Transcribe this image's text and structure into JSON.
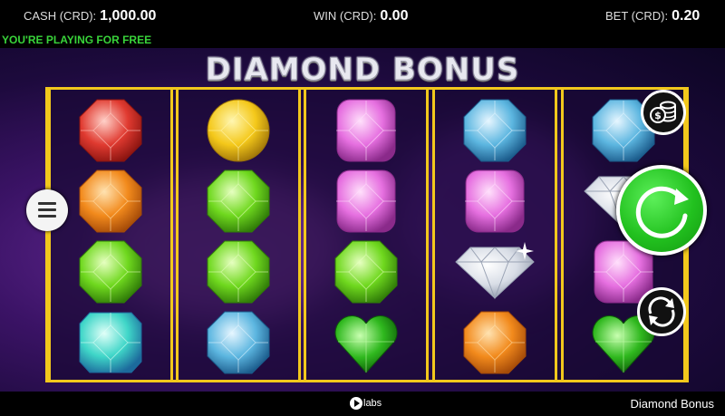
{
  "header": {
    "cash_label": "CASH (CRD):",
    "cash_value": "1,000.00",
    "win_label": "WIN (CRD):",
    "win_value": "0.00",
    "bet_label": "BET (CRD):",
    "bet_value": "0.20"
  },
  "banner": {
    "free_play": "YOU'RE PLAYING FOR FREE"
  },
  "game": {
    "title": "DIAMOND BONUS"
  },
  "reels": [
    [
      "red-gem",
      "orange-gem",
      "green-gem",
      "cyan-square-gem"
    ],
    [
      "yellow-gem",
      "green-gem",
      "green-gem",
      "blue-gem"
    ],
    [
      "pink-gem",
      "pink-gem",
      "green-gem",
      "green-heart-gem"
    ],
    [
      "blue-gem",
      "pink-gem",
      "diamond",
      "orange-gem"
    ],
    [
      "blue-gem",
      "diamond",
      "pink-gem",
      "green-heart-gem"
    ]
  ],
  "colors": {
    "reel_frame": "#f2c81c",
    "spin_button": "#22c11f",
    "free_play_text": "#39d43a"
  },
  "icons": {
    "menu": "hamburger-icon",
    "bet": "coin-stack-icon",
    "spin": "spin-arrow-icon",
    "autoplay": "autoplay-arrows-icon"
  },
  "footer": {
    "brand_text": "labs",
    "game_name": "Diamond Bonus"
  }
}
